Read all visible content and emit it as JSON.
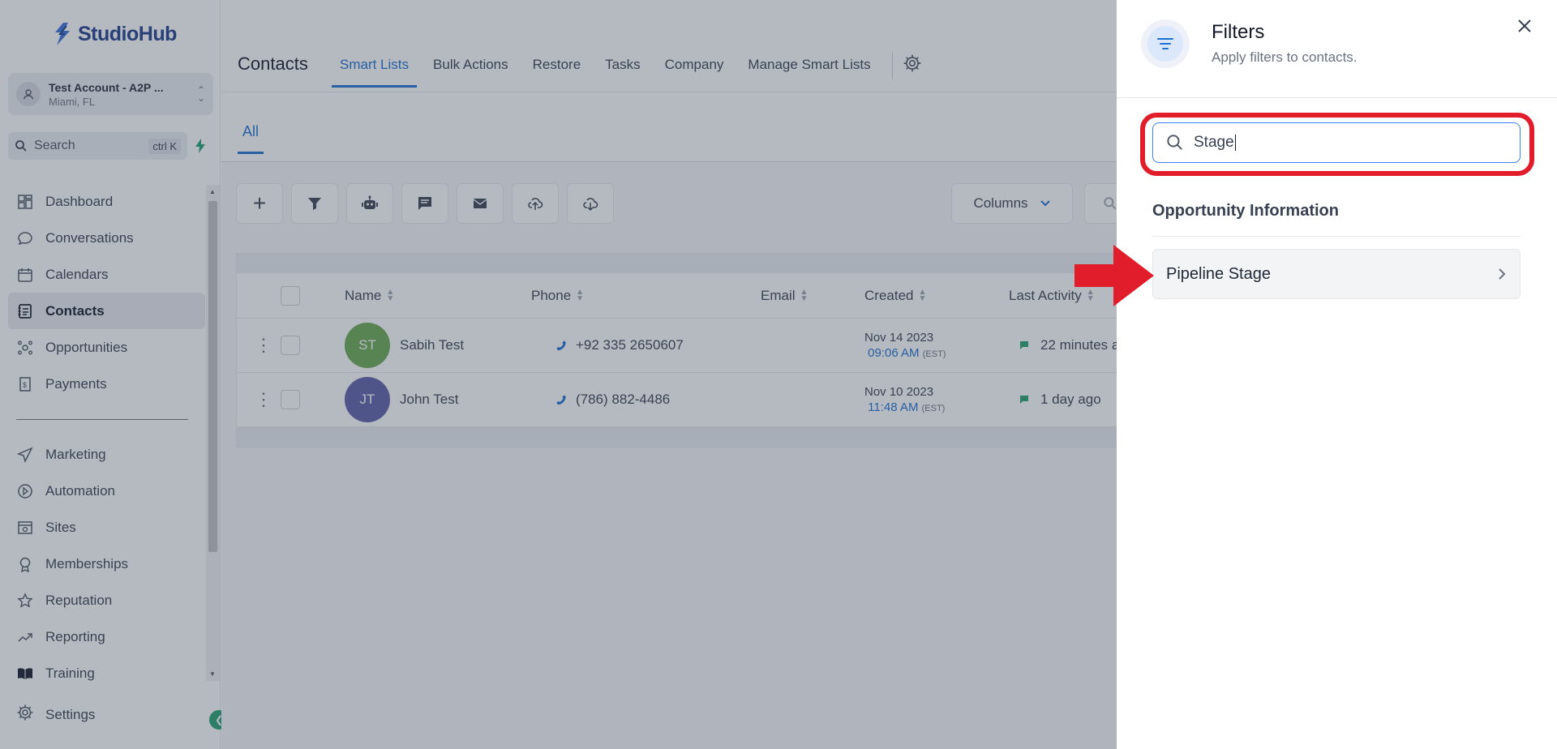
{
  "app": {
    "brand": "StudioHub"
  },
  "sidebar": {
    "account": {
      "name": "Test Account - A2P ...",
      "location": "Miami, FL"
    },
    "search": {
      "label": "Search",
      "shortcut": "ctrl K"
    },
    "items": [
      {
        "label": "Dashboard",
        "icon": "dashboard-icon"
      },
      {
        "label": "Conversations",
        "icon": "chat-icon"
      },
      {
        "label": "Calendars",
        "icon": "calendar-icon"
      },
      {
        "label": "Contacts",
        "icon": "contacts-icon",
        "active": true
      },
      {
        "label": "Opportunities",
        "icon": "opportunities-icon"
      },
      {
        "label": "Payments",
        "icon": "payments-icon"
      }
    ],
    "items2": [
      {
        "label": "Marketing",
        "icon": "send-icon"
      },
      {
        "label": "Automation",
        "icon": "automation-icon"
      },
      {
        "label": "Sites",
        "icon": "sites-icon"
      },
      {
        "label": "Memberships",
        "icon": "memberships-icon"
      },
      {
        "label": "Reputation",
        "icon": "star-icon"
      },
      {
        "label": "Reporting",
        "icon": "trend-icon"
      },
      {
        "label": "Training",
        "icon": "book-icon"
      }
    ],
    "settings": "Settings"
  },
  "header": {
    "title": "Contacts",
    "tabs": [
      "Smart Lists",
      "Bulk Actions",
      "Restore",
      "Tasks",
      "Company",
      "Manage Smart Lists"
    ]
  },
  "subtabs": {
    "all": "All"
  },
  "toolbar": {
    "columns": "Columns"
  },
  "table": {
    "headers": {
      "name": "Name",
      "phone": "Phone",
      "email": "Email",
      "created": "Created",
      "last_activity": "Last Activity"
    },
    "rows": [
      {
        "initials": "ST",
        "avatar_color": "#6aa84f",
        "name": "Sabih Test",
        "phone": "+92 335 2650607",
        "created_date": "Nov 14 2023",
        "created_time": "09:06 AM",
        "tz": "(EST)",
        "activity": "22 minutes ago"
      },
      {
        "initials": "JT",
        "avatar_color": "#5b5ea6",
        "name": "John Test",
        "phone": "(786) 882-4486",
        "created_date": "Nov 10 2023",
        "created_time": "11:48 AM",
        "tz": "(EST)",
        "activity": "1 day ago"
      }
    ]
  },
  "filters": {
    "title": "Filters",
    "subtitle": "Apply filters to contacts.",
    "search_value": "Stage",
    "section": "Opportunity Information",
    "option": "Pipeline Stage"
  },
  "colors": {
    "accent": "#1d6fd1",
    "annotation": "#e11d2b"
  }
}
